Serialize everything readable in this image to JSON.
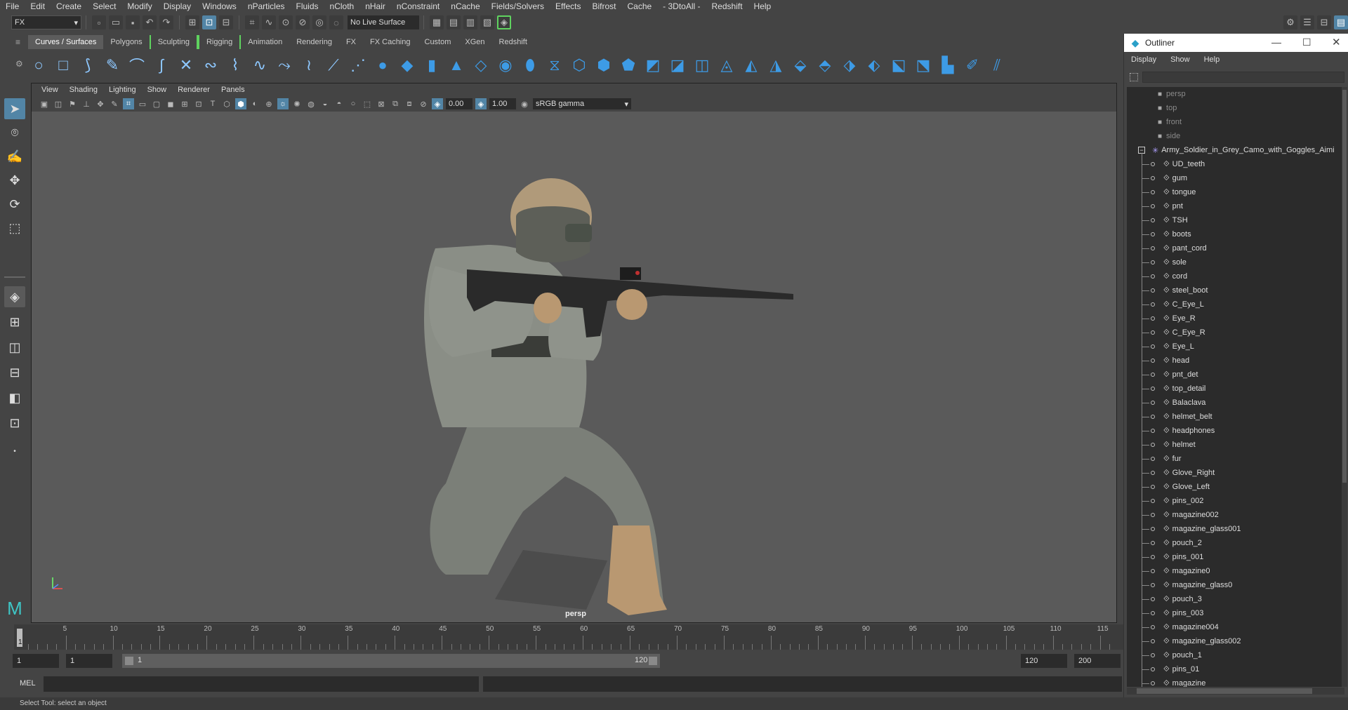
{
  "menubar": [
    "File",
    "Edit",
    "Create",
    "Select",
    "Modify",
    "Display",
    "Windows",
    "nParticles",
    "Fluids",
    "nCloth",
    "nHair",
    "nConstraint",
    "nCache",
    "Fields/Solvers",
    "Effects",
    "Bifrost",
    "Cache",
    "- 3DtoAll -",
    "Redshift",
    "Help"
  ],
  "statusline": {
    "mode": "FX",
    "live_surface": "No Live Surface"
  },
  "shelf_tabs": [
    "Curves / Surfaces",
    "Polygons",
    "Sculpting",
    "Rigging",
    "Animation",
    "Rendering",
    "FX",
    "FX Caching",
    "Custom",
    "XGen",
    "Redshift"
  ],
  "panel_menu": [
    "View",
    "Shading",
    "Lighting",
    "Show",
    "Renderer",
    "Panels"
  ],
  "panel_toolbar": {
    "exposure": "0.00",
    "gamma": "1.00",
    "color_space": "sRGB gamma"
  },
  "viewport": {
    "camera_label": "persp"
  },
  "timeline": {
    "ticks": [
      "5",
      "10",
      "15",
      "20",
      "25",
      "30",
      "35",
      "40",
      "45",
      "50",
      "55",
      "60",
      "65",
      "70",
      "75",
      "80",
      "85",
      "90",
      "95",
      "100",
      "105",
      "110",
      "115"
    ],
    "current_frame": "1"
  },
  "range": {
    "start": "1",
    "current": "1",
    "slider_start": "1",
    "slider_end": "120",
    "end": "120",
    "max": "200"
  },
  "mel": {
    "label": "MEL"
  },
  "helpline": "Select Tool: select an object",
  "outliner": {
    "title": "Outliner",
    "menu": [
      "Display",
      "Show",
      "Help"
    ],
    "cameras": [
      "persp",
      "top",
      "front",
      "side"
    ],
    "root": "Army_Soldier_in_Grey_Camo_with_Goggles_Aimi",
    "children": [
      "UD_teeth",
      "gum",
      "tongue",
      "pnt",
      "TSH",
      "boots",
      "pant_cord",
      "sole",
      "cord",
      "steel_boot",
      "C_Eye_L",
      "Eye_R",
      "C_Eye_R",
      "Eye_L",
      "head",
      "pnt_det",
      "top_detail",
      "Balaclava",
      "helmet_belt",
      "headphones",
      "helmet",
      "fur",
      "Glove_Right",
      "Glove_Left",
      "pins_002",
      "magazine002",
      "magazine_glass001",
      "pouch_2",
      "pins_001",
      "magazine0",
      "magazine_glass0",
      "pouch_3",
      "pins_003",
      "magazine004",
      "magazine_glass002",
      "pouch_1",
      "pins_01",
      "magazine"
    ]
  },
  "colors": {
    "accent": "#5285a6",
    "bg": "#444444",
    "viewport": "#5a5a5a",
    "green": "#5fd35f"
  }
}
